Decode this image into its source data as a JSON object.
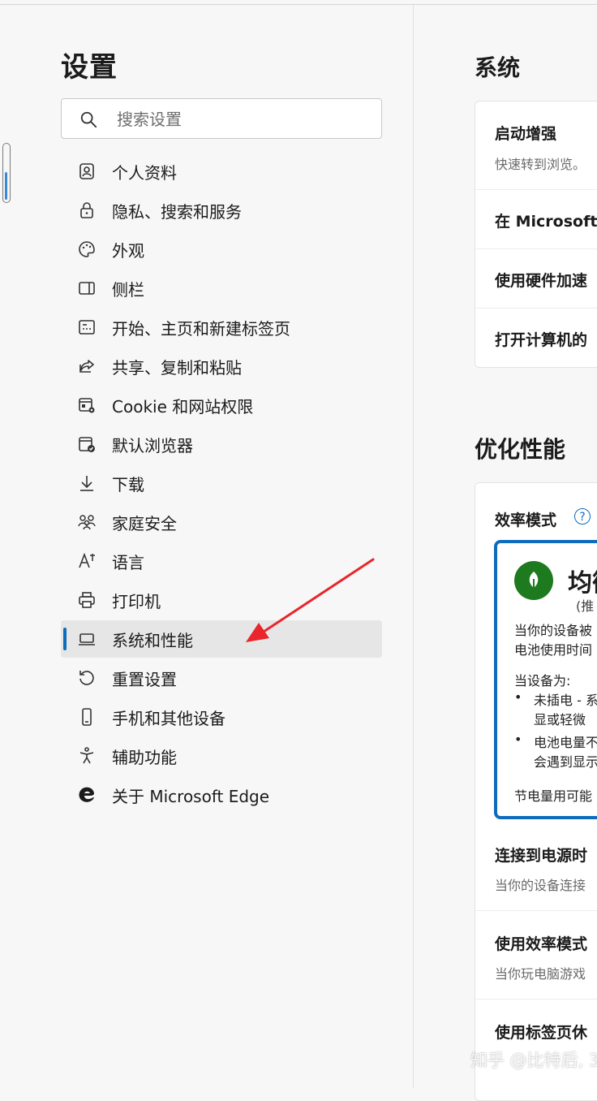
{
  "sidebar": {
    "title": "设置",
    "search": {
      "placeholder": "搜索设置",
      "value": ""
    },
    "items": [
      {
        "label": "个人资料",
        "icon": "profile-icon"
      },
      {
        "label": "隐私、搜索和服务",
        "icon": "lock-icon"
      },
      {
        "label": "外观",
        "icon": "palette-icon"
      },
      {
        "label": "侧栏",
        "icon": "sidebar-icon"
      },
      {
        "label": "开始、主页和新建标签页",
        "icon": "home-tab-icon"
      },
      {
        "label": "共享、复制和粘贴",
        "icon": "share-icon"
      },
      {
        "label": "Cookie 和网站权限",
        "icon": "site-permissions-icon"
      },
      {
        "label": "默认浏览器",
        "icon": "default-browser-icon"
      },
      {
        "label": "下载",
        "icon": "download-icon"
      },
      {
        "label": "家庭安全",
        "icon": "family-icon"
      },
      {
        "label": "语言",
        "icon": "language-icon"
      },
      {
        "label": "打印机",
        "icon": "printer-icon"
      },
      {
        "label": "系统和性能",
        "icon": "laptop-icon",
        "selected": true
      },
      {
        "label": "重置设置",
        "icon": "reset-icon"
      },
      {
        "label": "手机和其他设备",
        "icon": "phone-icon"
      },
      {
        "label": "辅助功能",
        "icon": "accessibility-icon"
      },
      {
        "label": "关于 Microsoft Edge",
        "icon": "edge-logo-icon"
      }
    ]
  },
  "main": {
    "system": {
      "title": "系统",
      "rows": [
        {
          "title": "启动增强",
          "sub": "快速转到浏览。"
        },
        {
          "title": "在 Microsoft"
        },
        {
          "title": "使用硬件加速"
        },
        {
          "title": "打开计算机的"
        }
      ]
    },
    "performance": {
      "title": "优化性能",
      "efficiency": {
        "title": "效率模式",
        "help_icon": "help-icon",
        "option_title": "均衡",
        "option_sub": "(推",
        "desc_line1": "当你的设备被",
        "desc_line2": "电池使用时间",
        "when_label": "当设备为:",
        "bullets": [
          {
            "l1": "未插电 - 系",
            "l2": "显或轻微"
          },
          {
            "l1": "电池电量不",
            "l2": "会遇到显示"
          }
        ],
        "saving": "节电量用可能"
      },
      "rows": [
        {
          "title": "连接到电源时",
          "sub": "当你的设备连接"
        },
        {
          "title": "使用效率模式",
          "sub": "当你玩电脑游戏"
        },
        {
          "title": "使用标签页休"
        }
      ]
    }
  },
  "watermark": "知乎 @比特后, 3"
}
